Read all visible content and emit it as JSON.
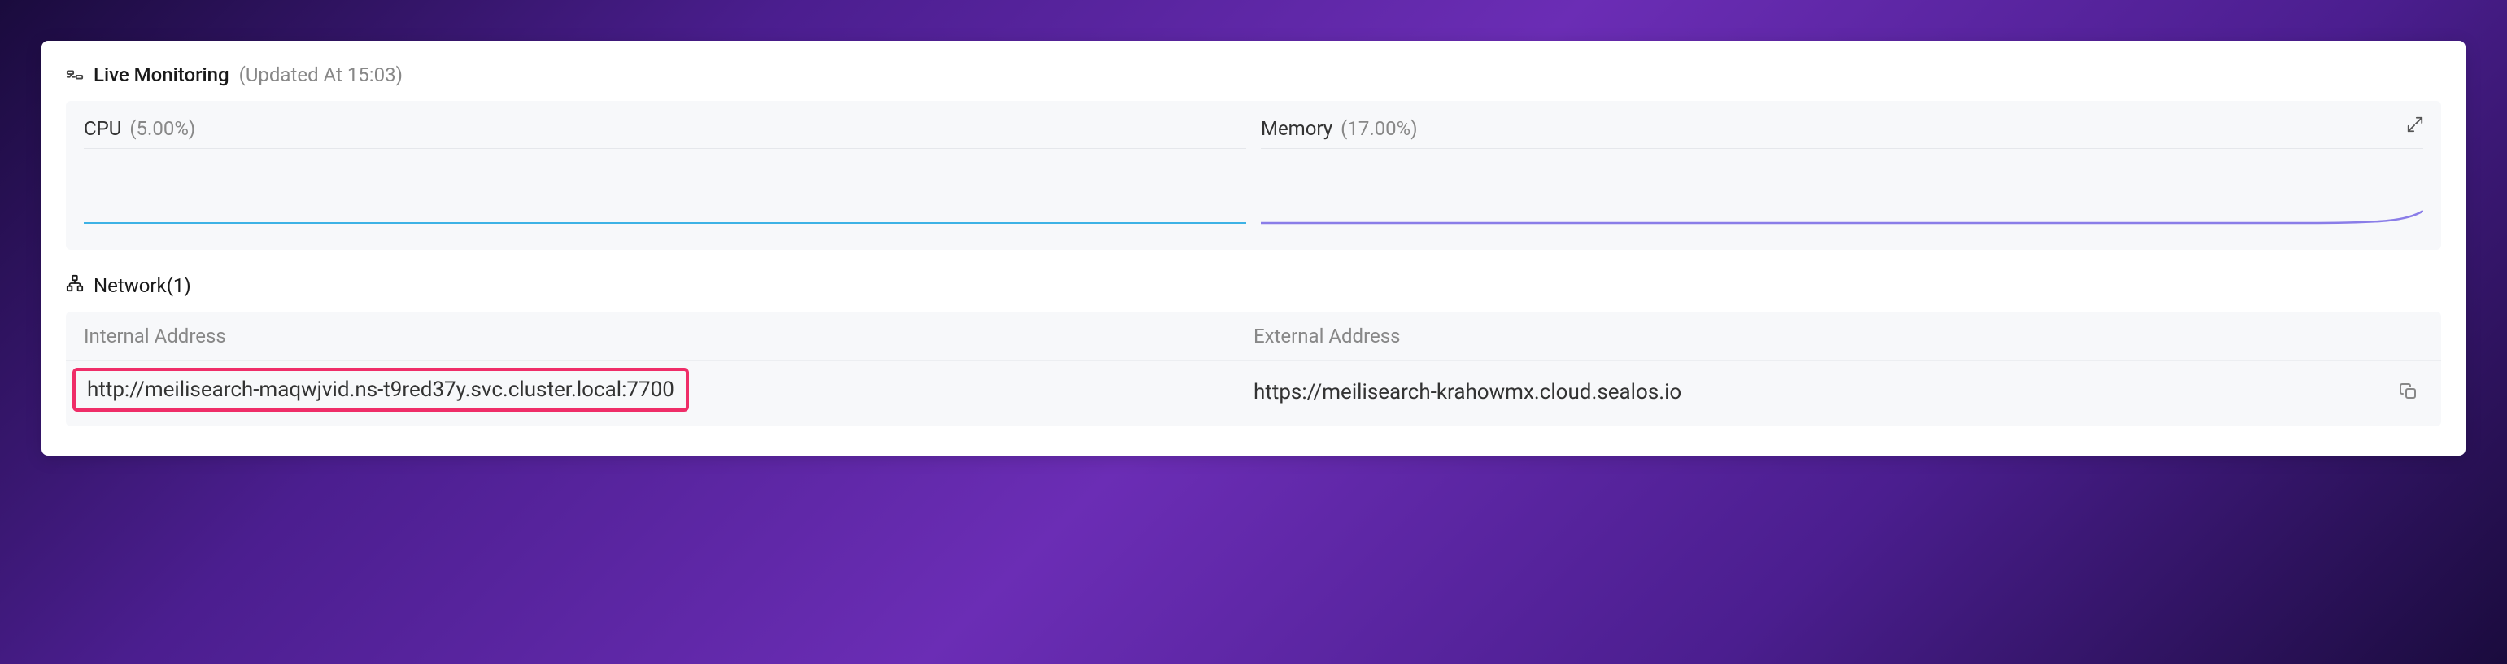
{
  "monitoring": {
    "title": "Live Monitoring",
    "updated_label": "(Updated At  15:03)"
  },
  "network_header": {
    "title": "Network",
    "count": "(1)",
    "internal_label": "Internal Address",
    "external_label": "External Address"
  },
  "network_row": {
    "internal": "http://meilisearch-maqwjvid.ns-t9red37y.svc.cluster.local:7700",
    "external": "https://meilisearch-krahowmx.cloud.sealos.io"
  },
  "chart_data": [
    {
      "type": "line",
      "title": "CPU",
      "value_label": "(5.00%)",
      "ylim": [
        0,
        100
      ],
      "values": [
        5,
        5,
        5,
        5,
        5,
        5,
        5,
        5,
        5,
        5,
        5,
        5,
        5,
        5,
        5,
        5,
        5,
        5,
        5,
        5
      ],
      "color": "#3db2e5"
    },
    {
      "type": "line",
      "title": "Memory",
      "value_label": "(17.00%)",
      "ylim": [
        0,
        100
      ],
      "values": [
        17,
        17,
        17,
        17,
        17,
        17,
        17,
        17,
        17,
        17,
        17,
        17,
        17,
        17,
        17,
        17,
        17,
        17,
        17.3,
        19
      ],
      "color": "#8a7de8"
    }
  ]
}
